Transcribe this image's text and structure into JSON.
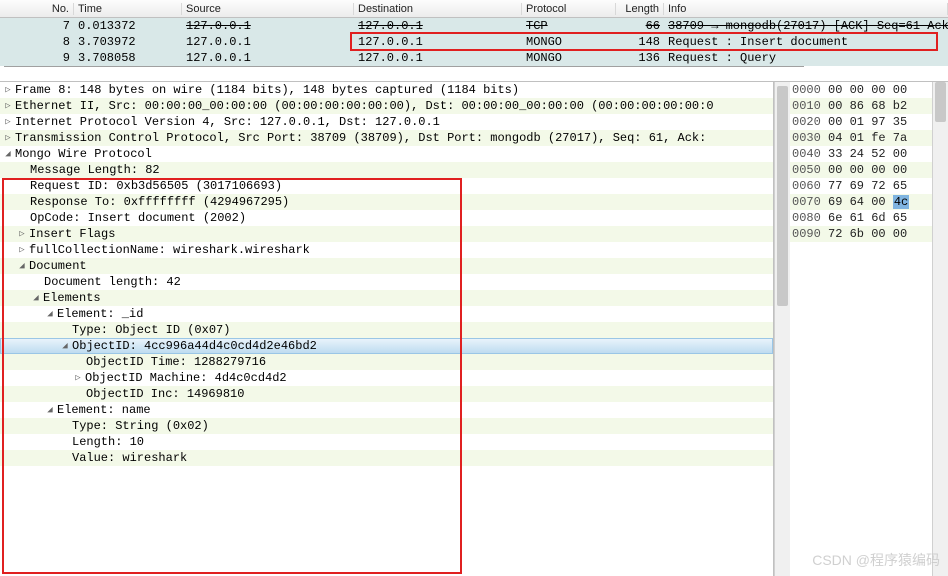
{
  "list": {
    "headers": {
      "no": "No.",
      "time": "Time",
      "src": "Source",
      "dst": "Destination",
      "proto": "Protocol",
      "len": "Length",
      "info": "Info"
    },
    "rows": [
      {
        "no": "7",
        "time": "0.013372",
        "src": "127.0.0.1",
        "dst": "127.0.0.1",
        "proto": "TCP",
        "len": "66",
        "info": "38709 → mongodb(27017) [ACK] Seq=61 Ack",
        "strike": true
      },
      {
        "no": "8",
        "time": "3.703972",
        "src": "127.0.0.1",
        "dst": "127.0.0.1",
        "proto": "MONGO",
        "len": "148",
        "info": "Request : Insert document"
      },
      {
        "no": "9",
        "time": "3.708058",
        "src": "127.0.0.1",
        "dst": "127.0.0.1",
        "proto": "MONGO",
        "len": "136",
        "info": "Request : Query"
      }
    ]
  },
  "det": {
    "frame": "Frame 8: 148 bytes on wire (1184 bits), 148 bytes captured (1184 bits)",
    "eth": "Ethernet II, Src: 00:00:00_00:00:00 (00:00:00:00:00:00), Dst: 00:00:00_00:00:00 (00:00:00:00:00:0",
    "ip": "Internet Protocol Version 4, Src: 127.0.0.1, Dst: 127.0.0.1",
    "tcp": "Transmission Control Protocol, Src Port: 38709 (38709), Dst Port: mongodb (27017), Seq: 61, Ack:",
    "mongo": "Mongo Wire Protocol",
    "msglen": "Message Length: 82",
    "reqid": "Request ID: 0xb3d56505 (3017106693)",
    "respto": "Response To: 0xffffffff (4294967295)",
    "opcode": "OpCode: Insert document (2002)",
    "insflags": "Insert Flags",
    "fullcol": "fullCollectionName: wireshark.wireshark",
    "doc": "Document",
    "doclen": "Document length: 42",
    "elements": "Elements",
    "el_id": "Element: _id",
    "type_oid": "Type: Object ID (0x07)",
    "objectid": "ObjectID: 4cc996a44d4c0cd4d2e46bd2",
    "oid_time": "ObjectID Time: 1288279716",
    "oid_mach": "ObjectID Machine: 4d4c0cd4d2",
    "oid_inc": "ObjectID Inc: 14969810",
    "el_name": "Element: name",
    "type_str": "Type: String (0x02)",
    "strlen": "Length: 10",
    "strval": "Value: wireshark"
  },
  "hex": {
    "o0": "0000",
    "b0": "00 00 00 00",
    "o1": "0010",
    "b1": "00 86 68 b2",
    "o2": "0020",
    "b2": "00 01 97 35",
    "o3": "0030",
    "b3": "04 01 fe 7a",
    "o4": "0040",
    "b4": "33 24 52 00",
    "o5": "0050",
    "b5": "00 00 00 00",
    "o6": "0060",
    "b6": "77 69 72 65",
    "o7": "0070",
    "b7a": "69 64 00 ",
    "b7b": "4c",
    "o8": "0080",
    "b8": "6e 61 6d 65",
    "o9": "0090",
    "b9": "72 6b 00 00"
  },
  "watermark": "CSDN @程序猿编码"
}
